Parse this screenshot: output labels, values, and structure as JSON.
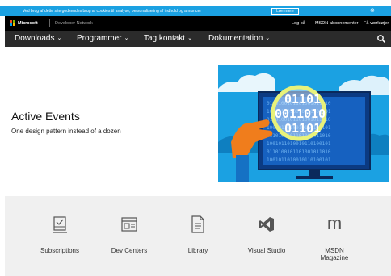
{
  "cookie_bar": {
    "text": "Ved brug af dette site godkendes brug af cookies til analyse, personalisering af indhold og annoncer",
    "button_label": "Lær mere",
    "close_glyph": "⊗",
    "color": "#1ba1e2"
  },
  "header": {
    "brand": "Microsoft",
    "site_name": "Developer Network",
    "links": [
      "Log på",
      "MSDN-abonnementer",
      "Få værktøjer"
    ]
  },
  "nav": {
    "items": [
      "Downloads",
      "Programmer",
      "Tag kontakt",
      "Dokumentation"
    ],
    "search_icon": "search-icon"
  },
  "hero": {
    "title": "Active Events",
    "subtitle": "One design pattern instead of a dozen",
    "art_text": [
      "01101",
      "0011010",
      "01101"
    ]
  },
  "quick_links": [
    {
      "label": "Subscriptions",
      "icon": "checklist-icon"
    },
    {
      "label": "Dev Centers",
      "icon": "dev-centers-icon"
    },
    {
      "label": "Library",
      "icon": "document-icon"
    },
    {
      "label": "Visual Studio",
      "icon": "visual-studio-icon"
    },
    {
      "label": "MSDN Magazine",
      "icon": "magazine-m-icon",
      "glyph": "m"
    }
  ]
}
